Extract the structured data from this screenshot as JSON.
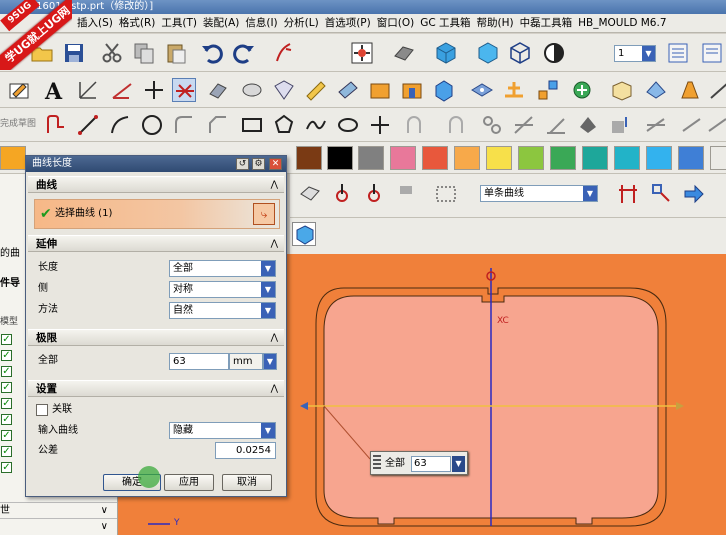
{
  "window": {
    "title": "...M16010.stp.prt（修改的）]"
  },
  "logo": {
    "text": "学UG就上UG网",
    "sub": "9SUG"
  },
  "menubar": {
    "items": [
      "插入(S)",
      "格式(R)",
      "工具(T)",
      "装配(A)",
      "信息(I)",
      "分析(L)",
      "首选项(P)",
      "窗口(O)",
      "GC 工具箱",
      "帮助(H)",
      "中磊工具箱",
      "HB_MOULD M6.7"
    ]
  },
  "toolbar": {
    "layer_select": "1",
    "sketch_label": "完成草图"
  },
  "palette": {
    "colors": [
      "#f5a623",
      "#7a3a14",
      "#000000",
      "#808080",
      "#e8789a",
      "#e8583c",
      "#f7a94a",
      "#f7e04a",
      "#8cc63f",
      "#3aa856",
      "#1ea79a",
      "#22b3c8",
      "#33b2ee",
      "#3f7fd6"
    ]
  },
  "selection_bar": {
    "filter": "单条曲线"
  },
  "navigator": {
    "labels": [
      "的曲",
      "件导",
      "模型",
      "世"
    ],
    "rows": 9,
    "bottom_dropdowns": [
      "∨",
      "∨"
    ]
  },
  "dialog": {
    "title": "曲线长度",
    "sections": {
      "curve": "曲线",
      "extend": "延伸",
      "limits": "极限",
      "settings": "设置"
    },
    "select_curve": "选择曲线 (1)",
    "length_label": "长度",
    "length_value": "全部",
    "side_label": "侧",
    "side_value": "对称",
    "method_label": "方法",
    "method_value": "自然",
    "total_label": "全部",
    "total_value": "63",
    "total_unit": "mm",
    "associative_label": "关联",
    "input_curve_label": "输入曲线",
    "input_curve_value": "隐藏",
    "tolerance_label": "公差",
    "tolerance_value": "0.0254",
    "ok": "确定",
    "apply": "应用",
    "cancel": "取消"
  },
  "canvas": {
    "axis_label": "XC",
    "input_label": "全部",
    "input_value": "63",
    "coord_label": "Y"
  }
}
